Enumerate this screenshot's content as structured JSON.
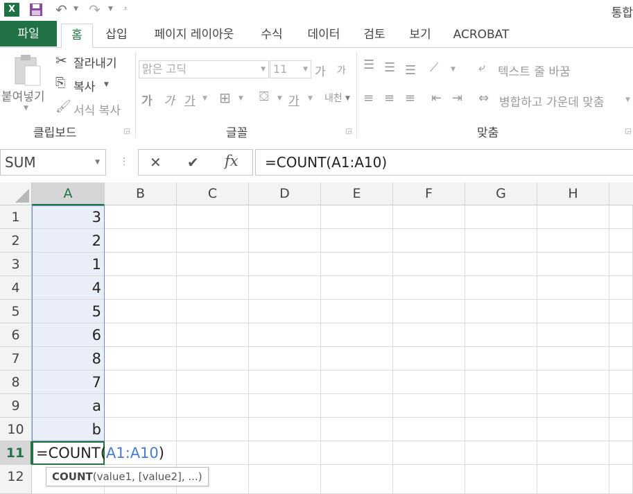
{
  "app": {
    "title": "통합",
    "icon": "excel-icon"
  },
  "qat": {
    "save_icon": "save-icon",
    "undo_icon": "undo-icon",
    "redo_icon": "redo-icon",
    "customize_icon": "customize-icon"
  },
  "tabs": [
    {
      "label": "파일"
    },
    {
      "label": "홈"
    },
    {
      "label": "삽입"
    },
    {
      "label": "페이지 레이아웃"
    },
    {
      "label": "수식"
    },
    {
      "label": "데이터"
    },
    {
      "label": "검토"
    },
    {
      "label": "보기"
    },
    {
      "label": "ACROBAT"
    }
  ],
  "ribbon": {
    "clipboard": {
      "paste": "붙여넣기",
      "cut": "잘라내기",
      "copy": "복사",
      "format_painter": "서식 복사",
      "group": "클립보드"
    },
    "font": {
      "name": "맑은 고딕",
      "size": "11",
      "grow": "가",
      "shrink": "가",
      "bold": "가",
      "italic": "가",
      "underline": "가",
      "font_color": "가",
      "phonetic": "내천",
      "group": "글꼴"
    },
    "alignment": {
      "wrap_text": "텍스트 줄 바꿈",
      "merge_center": "병합하고 가운데 맞춤",
      "group": "맞춤"
    }
  },
  "formula_bar": {
    "name_box": "SUM",
    "cancel": "✕",
    "enter": "✔",
    "fx": "fx",
    "formula": "=COUNT(A1:A10)"
  },
  "grid": {
    "columns": [
      "A",
      "B",
      "C",
      "D",
      "E",
      "F",
      "G",
      "H"
    ],
    "rows": [
      "1",
      "2",
      "3",
      "4",
      "5",
      "6",
      "7",
      "8",
      "9",
      "10",
      "11",
      "12"
    ],
    "col_a_values": [
      "3",
      "2",
      "1",
      "4",
      "5",
      "6",
      "8",
      "7",
      "a",
      "b"
    ],
    "edit": {
      "prefix": "=COUNT(",
      "ref": "A1:A10",
      "suffix": ")"
    },
    "tooltip": {
      "func": "COUNT",
      "args": "(value1, [value2], ...)"
    }
  },
  "colors": {
    "accent": "#217346",
    "reference": "#4b7ad6",
    "reference_fill": "#e9eef9"
  }
}
